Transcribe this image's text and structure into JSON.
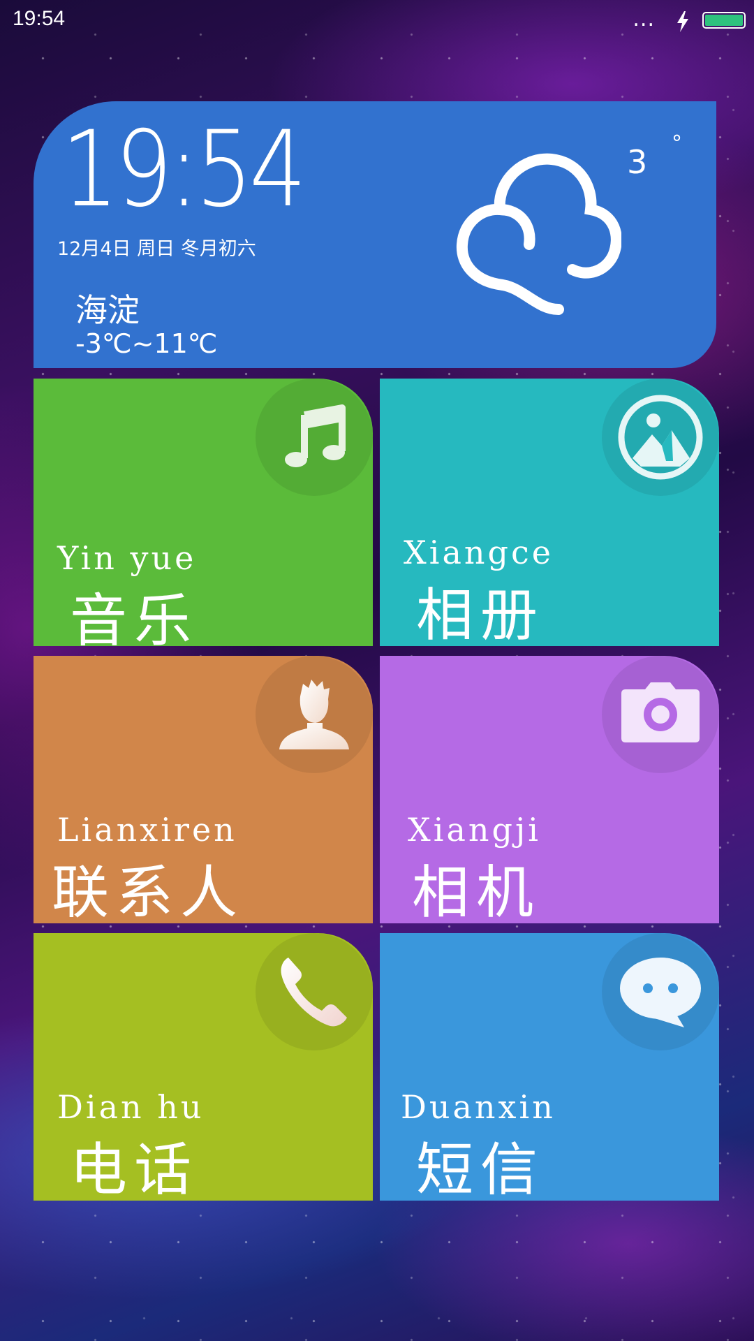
{
  "status_bar": {
    "time": "19:54",
    "dots": "...",
    "battery_color": "#2ec27e"
  },
  "weather": {
    "clock": "19:54",
    "date": "12月4日 周日 冬月初六",
    "city": "海淀",
    "temp_range": "-3℃~11℃",
    "current_temp": "3",
    "degree": "°",
    "icon": "cloud-icon",
    "color": "#3272cf"
  },
  "tiles": [
    {
      "pinyin": "Yin yue",
      "label": "音乐",
      "icon": "music-note-icon",
      "color": "#5bbb3a"
    },
    {
      "pinyin": "Xiangce",
      "label": "相册",
      "icon": "gallery-icon",
      "color": "#26b9bf"
    },
    {
      "pinyin": "Lianxiren",
      "label": "联系人",
      "icon": "contact-icon",
      "color": "#d1864a"
    },
    {
      "pinyin": "Xiangji",
      "label": "相机",
      "icon": "camera-icon",
      "color": "#b56ae5"
    },
    {
      "pinyin": "Dian hu",
      "label": "电话",
      "icon": "phone-icon",
      "color": "#a5bf22"
    },
    {
      "pinyin": "Duanxin",
      "label": "短信",
      "icon": "message-icon",
      "color": "#3a97dc"
    }
  ]
}
